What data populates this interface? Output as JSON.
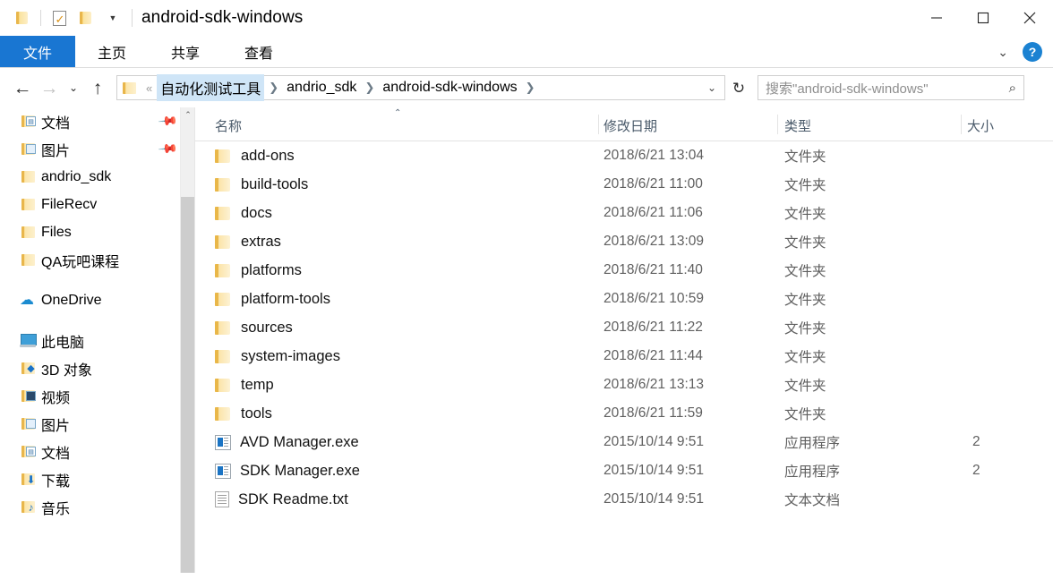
{
  "window": {
    "title": "android-sdk-windows",
    "quick_access": [
      {
        "name": "folder-icon",
        "glyph": "folder"
      },
      {
        "name": "properties-icon",
        "glyph": "checkmark-document"
      },
      {
        "name": "new-folder-icon",
        "glyph": "folder"
      },
      {
        "name": "customize-qat-caret",
        "glyph": "▾"
      }
    ],
    "controls": {
      "minimize": "minimize-icon",
      "maximize": "maximize-icon",
      "close": "close-icon"
    }
  },
  "ribbon": {
    "tabs": [
      {
        "label": "文件",
        "active": true
      },
      {
        "label": "主页",
        "active": false
      },
      {
        "label": "共享",
        "active": false
      },
      {
        "label": "查看",
        "active": false
      }
    ],
    "expand_caret": "⌄",
    "help_label": "?"
  },
  "address": {
    "back": "←",
    "forward": "→",
    "recent_caret": "⌄",
    "up": "↑",
    "overflow": "«",
    "crumbs": [
      {
        "label": "自动化测试工具",
        "highlighted": true
      },
      {
        "label": "andrio_sdk",
        "highlighted": false
      },
      {
        "label": "android-sdk-windows",
        "highlighted": false
      }
    ],
    "dropdown": "⌄",
    "refresh": "↻"
  },
  "search": {
    "placeholder": "搜索\"android-sdk-windows\"",
    "icon": "search-icon"
  },
  "sidebar": {
    "quick_access_items": [
      {
        "label": "文档",
        "icon": "folder-documents-icon",
        "pinned": true
      },
      {
        "label": "图片",
        "icon": "folder-pictures-icon",
        "pinned": true
      },
      {
        "label": "andrio_sdk",
        "icon": "folder-icon",
        "pinned": false
      },
      {
        "label": "FileRecv",
        "icon": "folder-icon",
        "pinned": false
      },
      {
        "label": "Files",
        "icon": "folder-icon",
        "pinned": false
      },
      {
        "label": "QA玩吧课程",
        "icon": "folder-icon",
        "pinned": false
      }
    ],
    "onedrive": {
      "label": "OneDrive",
      "icon": "onedrive-cloud-icon"
    },
    "this_pc": {
      "label": "此电脑",
      "icon": "this-pc-icon"
    },
    "this_pc_items": [
      {
        "label": "3D 对象",
        "icon": "folder-3d-objects-icon"
      },
      {
        "label": "视频",
        "icon": "folder-videos-icon"
      },
      {
        "label": "图片",
        "icon": "folder-pictures-icon"
      },
      {
        "label": "文档",
        "icon": "folder-documents-icon"
      },
      {
        "label": "下载",
        "icon": "folder-downloads-icon"
      },
      {
        "label": "音乐",
        "icon": "folder-music-icon"
      }
    ],
    "scrollbar": {
      "up_arrow": "⌃"
    }
  },
  "file_list": {
    "columns": [
      {
        "label": "名称",
        "sorted": true,
        "sort_caret": "⌃"
      },
      {
        "label": "修改日期",
        "sorted": false
      },
      {
        "label": "类型",
        "sorted": false
      },
      {
        "label": "大小",
        "sorted": false
      }
    ],
    "rows": [
      {
        "name": "add-ons",
        "date": "2018/6/21 13:04",
        "type": "文件夹",
        "size": "",
        "icon": "folder-icon"
      },
      {
        "name": "build-tools",
        "date": "2018/6/21 11:00",
        "type": "文件夹",
        "size": "",
        "icon": "folder-icon"
      },
      {
        "name": "docs",
        "date": "2018/6/21 11:06",
        "type": "文件夹",
        "size": "",
        "icon": "folder-icon"
      },
      {
        "name": "extras",
        "date": "2018/6/21 13:09",
        "type": "文件夹",
        "size": "",
        "icon": "folder-icon"
      },
      {
        "name": "platforms",
        "date": "2018/6/21 11:40",
        "type": "文件夹",
        "size": "",
        "icon": "folder-icon"
      },
      {
        "name": "platform-tools",
        "date": "2018/6/21 10:59",
        "type": "文件夹",
        "size": "",
        "icon": "folder-icon"
      },
      {
        "name": "sources",
        "date": "2018/6/21 11:22",
        "type": "文件夹",
        "size": "",
        "icon": "folder-icon"
      },
      {
        "name": "system-images",
        "date": "2018/6/21 11:44",
        "type": "文件夹",
        "size": "",
        "icon": "folder-icon"
      },
      {
        "name": "temp",
        "date": "2018/6/21 13:13",
        "type": "文件夹",
        "size": "",
        "icon": "folder-icon"
      },
      {
        "name": "tools",
        "date": "2018/6/21 11:59",
        "type": "文件夹",
        "size": "",
        "icon": "folder-icon"
      },
      {
        "name": "AVD Manager.exe",
        "date": "2015/10/14 9:51",
        "type": "应用程序",
        "size": "2",
        "icon": "application-icon"
      },
      {
        "name": "SDK Manager.exe",
        "date": "2015/10/14 9:51",
        "type": "应用程序",
        "size": "2",
        "icon": "application-icon"
      },
      {
        "name": "SDK Readme.txt",
        "date": "2015/10/14 9:51",
        "type": "文本文档",
        "size": "",
        "icon": "text-document-icon"
      }
    ]
  },
  "colors": {
    "accent": "#1976d2",
    "crumb_highlight": "#cfe5f7",
    "folder_yellow": "#fcd679"
  }
}
